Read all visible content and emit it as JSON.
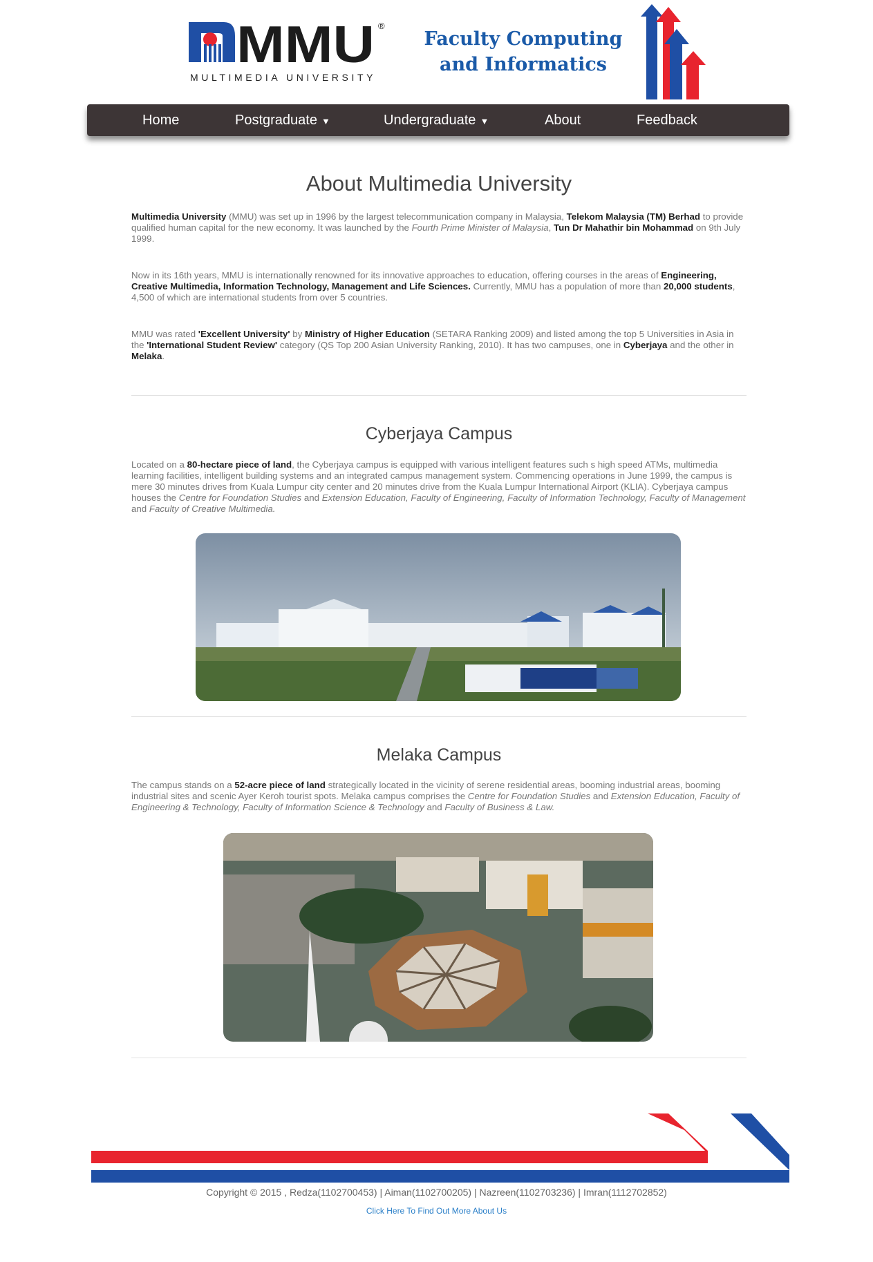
{
  "brand": {
    "logo_text": "MMU",
    "logo_subtitle": "MULTIMEDIA UNIVERSITY",
    "registered_mark": "®",
    "faculty_line1": "Faculty Computing",
    "faculty_line2": "and Informatics",
    "colors": {
      "red": "#e8242e",
      "blue": "#1f4fa5",
      "nav": "#3d3536"
    }
  },
  "nav": {
    "home": "Home",
    "postgraduate": "Postgraduate",
    "undergraduate": "Undergraduate",
    "about": "About",
    "feedback": "Feedback",
    "caret": "▼"
  },
  "about": {
    "title": "About Multimedia University",
    "p1": {
      "a": "Multimedia University",
      "b": " (MMU) was set up in 1996 by the largest telecommunication company in Malaysia, ",
      "c": "Telekom Malaysia (TM) Berhad",
      "d": " to provide qualified human capital for the new economy. It was launched by the ",
      "e": "Fourth Prime Minister of Malaysia",
      "f": ", ",
      "g": "Tun Dr Mahathir bin Mohammad",
      "h": " on 9th July 1999."
    },
    "p2": {
      "a": "Now in its 16th years, MMU is internationally renowned for its innovative approaches to education, offering courses in the areas of ",
      "b": "Engineering, Creative Multimedia, Information Technology, Management and Life Sciences.",
      "c": " Currently, MMU has a population of more than ",
      "d": "20,000 students",
      "e": ", 4,500 of which are international students from over 5 countries."
    },
    "p3": {
      "a": "MMU was rated ",
      "b": "'Excellent University'",
      "c": " by ",
      "d": "Ministry of Higher Education",
      "e": " (SETARA Ranking 2009) and listed among the top 5 Universities in Asia in the ",
      "f": "'International Student Review'",
      "g": " category (QS Top 200 Asian University Ranking, 2010). It has two campuses, one in ",
      "h": "Cyberjaya",
      "i": " and the other in ",
      "j": "Melaka",
      "k": "."
    }
  },
  "cyberjaya": {
    "title": "Cyberjaya Campus",
    "a": "Located on a ",
    "b": "80-hectare piece of land",
    "c": ", the Cyberjaya campus is equipped with various intelligent features such s high speed ATMs, multimedia learning facilities, intelligent building systems and an integrated campus management system. Commencing operations in June 1999, the campus is mere 30 minutes drives from Kuala Lumpur city center and 20 minutes drive from the Kuala Lumpur International Airport (KLIA). Cyberjaya campus houses the ",
    "d": "Centre for Foundation Studies",
    "e": " and ",
    "f": "Extension Education, Faculty of Engineering, Faculty of Information Technology, Faculty of Management",
    "g": " and ",
    "h": "Faculty of Creative Multimedia."
  },
  "melaka": {
    "title": "Melaka Campus",
    "a": "The campus stands on a ",
    "b": "52-acre piece of land",
    "c": " strategically located in the vicinity of serene residential areas, booming industrial areas, booming industrial sites and scenic Ayer Keroh tourist spots. Melaka campus comprises the ",
    "d": "Centre for Foundation Studies",
    "e": " and ",
    "f": "Extension Education, Faculty of Engineering & Technology, Faculty of Information Science & Technology",
    "g": " and ",
    "h": "Faculty of Business & Law."
  },
  "footer": {
    "copyright": "Copyright © 2015 , Redza(1102700453) | Aiman(1102700205) | Nazreen(1102703236) | Imran(1112702852)",
    "link": "Click Here To Find Out More About Us"
  }
}
